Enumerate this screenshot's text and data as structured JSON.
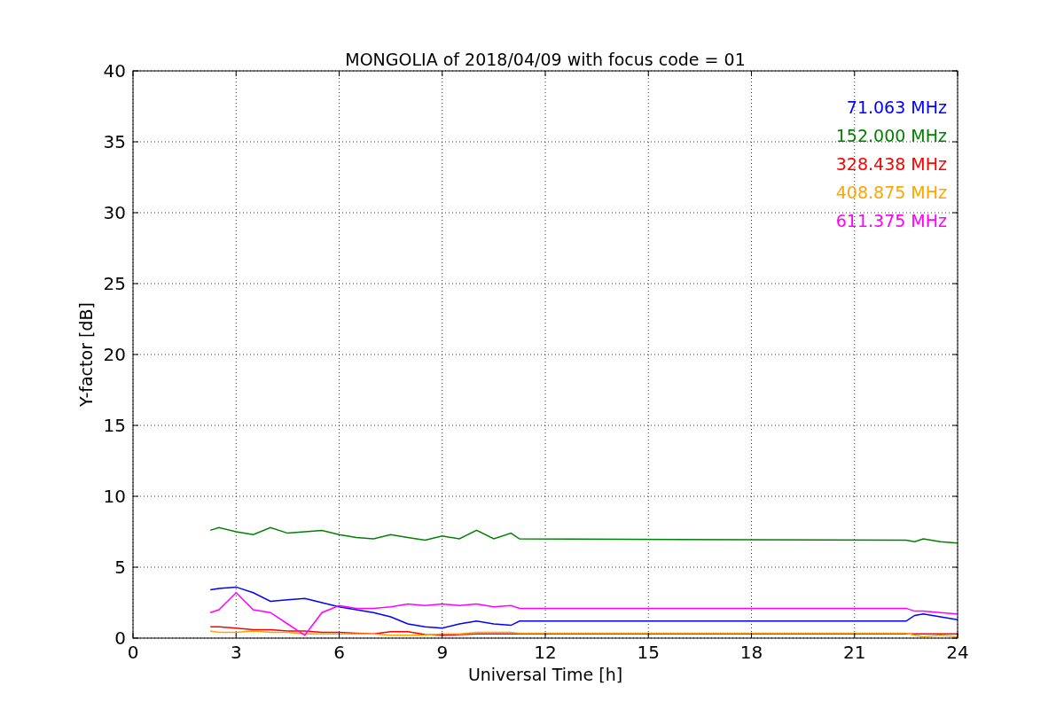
{
  "figure": {
    "chart_data": {
      "type": "line",
      "title": "MONGOLIA of 2018/04/09 with focus code = 01",
      "xlabel": "Universal Time [h]",
      "ylabel": "Y-factor [dB]",
      "x": [
        2.25,
        2.5,
        3,
        3.5,
        4,
        4.5,
        5,
        5.5,
        6,
        6.5,
        7,
        7.5,
        8,
        8.5,
        9,
        9.5,
        10,
        10.5,
        11,
        11.25,
        22.5,
        22.75,
        23,
        23.5,
        24
      ],
      "series": [
        {
          "name": "71.063 MHz",
          "color": "#0000ff",
          "values": [
            3.4,
            3.5,
            3.6,
            3.2,
            2.6,
            2.7,
            2.8,
            2.5,
            2.2,
            2.0,
            1.8,
            1.5,
            1.0,
            0.8,
            0.7,
            1.0,
            1.2,
            1.0,
            0.9,
            1.2,
            1.2,
            1.6,
            1.7,
            1.5,
            1.3
          ]
        },
        {
          "name": "152.000 MHz",
          "color": "#008000",
          "values": [
            7.6,
            7.8,
            7.5,
            7.3,
            7.8,
            7.4,
            7.5,
            7.6,
            7.3,
            7.1,
            7.0,
            7.3,
            7.1,
            6.9,
            7.2,
            7.0,
            7.6,
            7.0,
            7.4,
            7.0,
            6.9,
            6.8,
            7.0,
            6.8,
            6.7
          ]
        },
        {
          "name": "328.438 MHz",
          "color": "#ff0000",
          "values": [
            0.8,
            0.8,
            0.7,
            0.6,
            0.6,
            0.5,
            0.5,
            0.4,
            0.4,
            0.35,
            0.3,
            0.45,
            0.45,
            0.25,
            0.2,
            0.25,
            0.3,
            0.3,
            0.3,
            0.3,
            0.3,
            0.3,
            0.3,
            0.3,
            0.3
          ]
        },
        {
          "name": "408.875 MHz",
          "color": "#ffa500",
          "values": [
            0.5,
            0.4,
            0.4,
            0.5,
            0.4,
            0.4,
            0.3,
            0.3,
            0.3,
            0.3,
            0.3,
            0.2,
            0.2,
            0.2,
            0.3,
            0.3,
            0.4,
            0.4,
            0.4,
            0.35,
            0.35,
            0.2,
            0.1,
            0.2,
            0.1
          ]
        },
        {
          "name": "611.375 MHz",
          "color": "#ff00ff",
          "values": [
            1.8,
            2.0,
            3.2,
            2.0,
            1.8,
            1.0,
            0.2,
            1.8,
            2.3,
            2.1,
            2.1,
            2.2,
            2.4,
            2.3,
            2.4,
            2.3,
            2.4,
            2.2,
            2.3,
            2.1,
            2.1,
            1.9,
            1.9,
            1.8,
            1.7
          ]
        }
      ],
      "grid": true,
      "xlim": [
        0,
        24
      ],
      "ylim": [
        0,
        40
      ],
      "xticks": [
        0,
        3,
        6,
        9,
        12,
        15,
        18,
        21,
        24
      ],
      "yticks": [
        0,
        5,
        10,
        15,
        20,
        25,
        30,
        35,
        40
      ]
    }
  }
}
